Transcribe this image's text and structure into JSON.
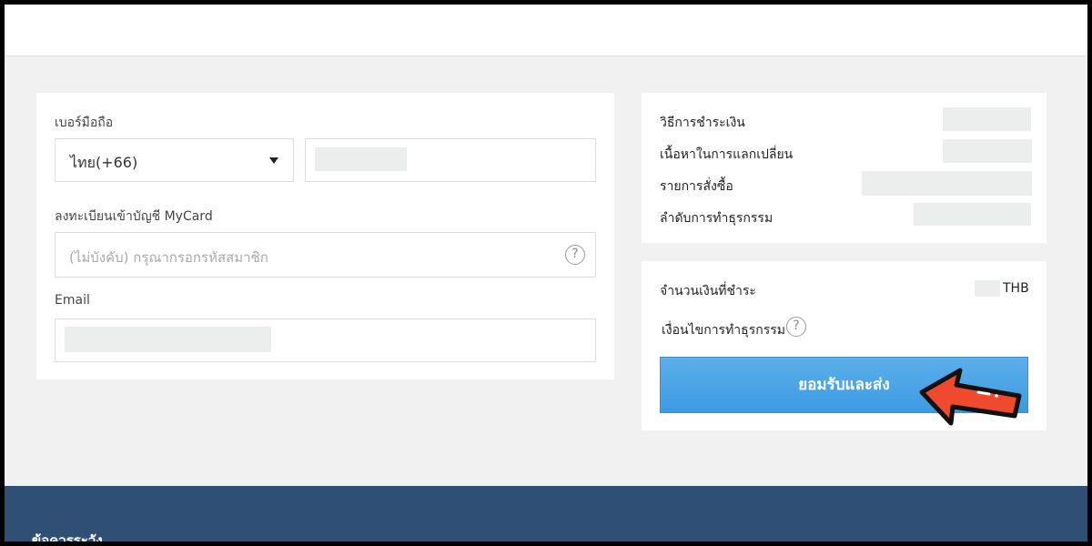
{
  "form": {
    "phone_label": "เบอร์มือถือ",
    "country_selected": "ไทย(+66)",
    "member_label": "ลงทะเบียนเข้าบัญชี MyCard",
    "member_placeholder": "(ไม่บังคับ) กรุณากรอกรหัสสมาชิก",
    "email_label": "Email",
    "help_glyph": "?"
  },
  "order_info": {
    "payment_method": "วิธีการชำระเงิน",
    "exchange_content": "เนื้อหาในการแลกเปลี่ยน",
    "order_item": "รายการสั่งซื้อ",
    "transaction_order": "ลำดับการทำธุรกรรม"
  },
  "payment": {
    "amount_label": "จำนวนเงินที่ชำระ",
    "currency": "THB",
    "terms_label": "เงื่อนไขการทำธุรกรรม",
    "help_glyph": "?",
    "submit_label": "ยอมรับและส่ง"
  },
  "footer": {
    "title": "ข้อควรระวัง"
  },
  "colors": {
    "accent_button": "#4aa3e6",
    "footer_bg": "#2f4f75",
    "arrow_red": "#f04a2e"
  },
  "icons": {
    "dropdown": "caret-down-icon",
    "help": "question-circle-icon",
    "pointer": "red-arrow-icon"
  }
}
